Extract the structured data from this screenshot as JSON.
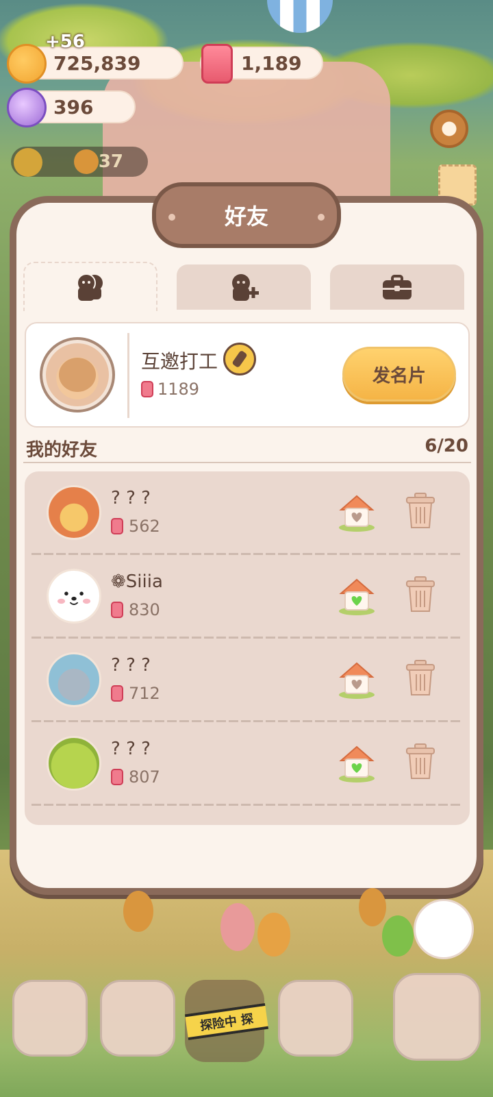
{
  "currency": {
    "coins": "725,839",
    "coins_delta": "+56",
    "candles": "1,189",
    "candy": "396",
    "helper_count": "37"
  },
  "panel": {
    "title": "好友"
  },
  "tabs": [
    {
      "icon": "friends-icon",
      "active": true
    },
    {
      "icon": "add-friend-icon",
      "active": false
    },
    {
      "icon": "briefcase-icon",
      "active": false
    }
  ],
  "profile": {
    "name": "互邀打工",
    "candles": "1189",
    "send_card_label": "发名片"
  },
  "friends_section": {
    "title": "我的好友",
    "count": "6/20"
  },
  "friends": [
    {
      "name": "? ? ?",
      "candles": "562",
      "house_color": "#b99a8c",
      "avatar_color": "#e58a4a"
    },
    {
      "name": "❁Siiia",
      "candles": "830",
      "house_color": "#6bd34a",
      "avatar_color": "#ffffff"
    },
    {
      "name": "? ? ?",
      "candles": "712",
      "house_color": "#b99a8c",
      "avatar_color": "#9ab8c7"
    },
    {
      "name": "? ? ?",
      "candles": "807",
      "house_color": "#6bd34a",
      "avatar_color": "#9cc33e"
    }
  ],
  "bottom_nav": {
    "adventure_label": "探险中 探"
  }
}
